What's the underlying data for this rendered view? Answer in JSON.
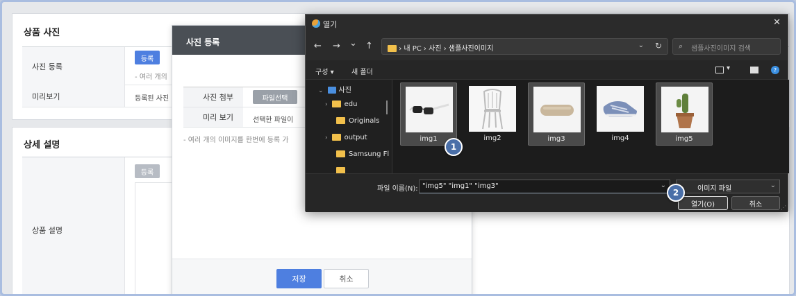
{
  "page": {
    "product_photo": {
      "title": "상품 사진",
      "register_label": "사진 등록",
      "register_button": "등록",
      "register_hint": "- 여러 개의",
      "preview_label": "미리보기",
      "preview_value": "등록된 사진"
    },
    "detail": {
      "title": "상세 설명",
      "register_button": "등록",
      "desc_label": "상품 설명"
    }
  },
  "modal": {
    "title": "사진 등록",
    "attach_label": "사진 첨부",
    "attach_button": "파일선택",
    "preview_label": "미리 보기",
    "preview_value": "선택한 파일이",
    "hint": "- 여러 개의 이미지를 한번에 등록 가",
    "save_button": "저장",
    "cancel_button": "취소"
  },
  "dialog": {
    "title": "열기",
    "close": "✕",
    "nav": {
      "back": "←",
      "forward": "→",
      "recent": "⌄",
      "up": "↑"
    },
    "address": "› 내 PC › 사진 › 샘플사진이미지",
    "search_placeholder": "샘플사진이미지 검색",
    "toolbar": {
      "organize": "구성 ▾",
      "new_folder": "새 폴더"
    },
    "tree": [
      {
        "label": "사진",
        "arrow": "⌄"
      },
      {
        "label": "edu",
        "arrow": "›"
      },
      {
        "label": "Originals",
        "arrow": ""
      },
      {
        "label": "output",
        "arrow": "›"
      },
      {
        "label": "Samsung Fl",
        "arrow": ""
      }
    ],
    "files": [
      {
        "name": "img1",
        "selected": true,
        "icon": "sunglasses-icon"
      },
      {
        "name": "img2",
        "selected": false,
        "icon": "chair-icon"
      },
      {
        "name": "img3",
        "selected": true,
        "icon": "cushion-icon"
      },
      {
        "name": "img4",
        "selected": false,
        "icon": "sneaker-icon"
      },
      {
        "name": "img5",
        "selected": true,
        "icon": "cactus-icon"
      }
    ],
    "filename_label": "파일 이름(N):",
    "filename_value": "\"img5\" \"img1\" \"img3\"",
    "filetype_value": "이미지 파일",
    "open_button": "열기(O)",
    "cancel_button": "취소"
  },
  "markers": [
    "1",
    "2"
  ],
  "colors": {
    "accent": "#4e7fe0",
    "marker": "#4a6fa8",
    "dialog_bg": "#1f1f1f"
  }
}
